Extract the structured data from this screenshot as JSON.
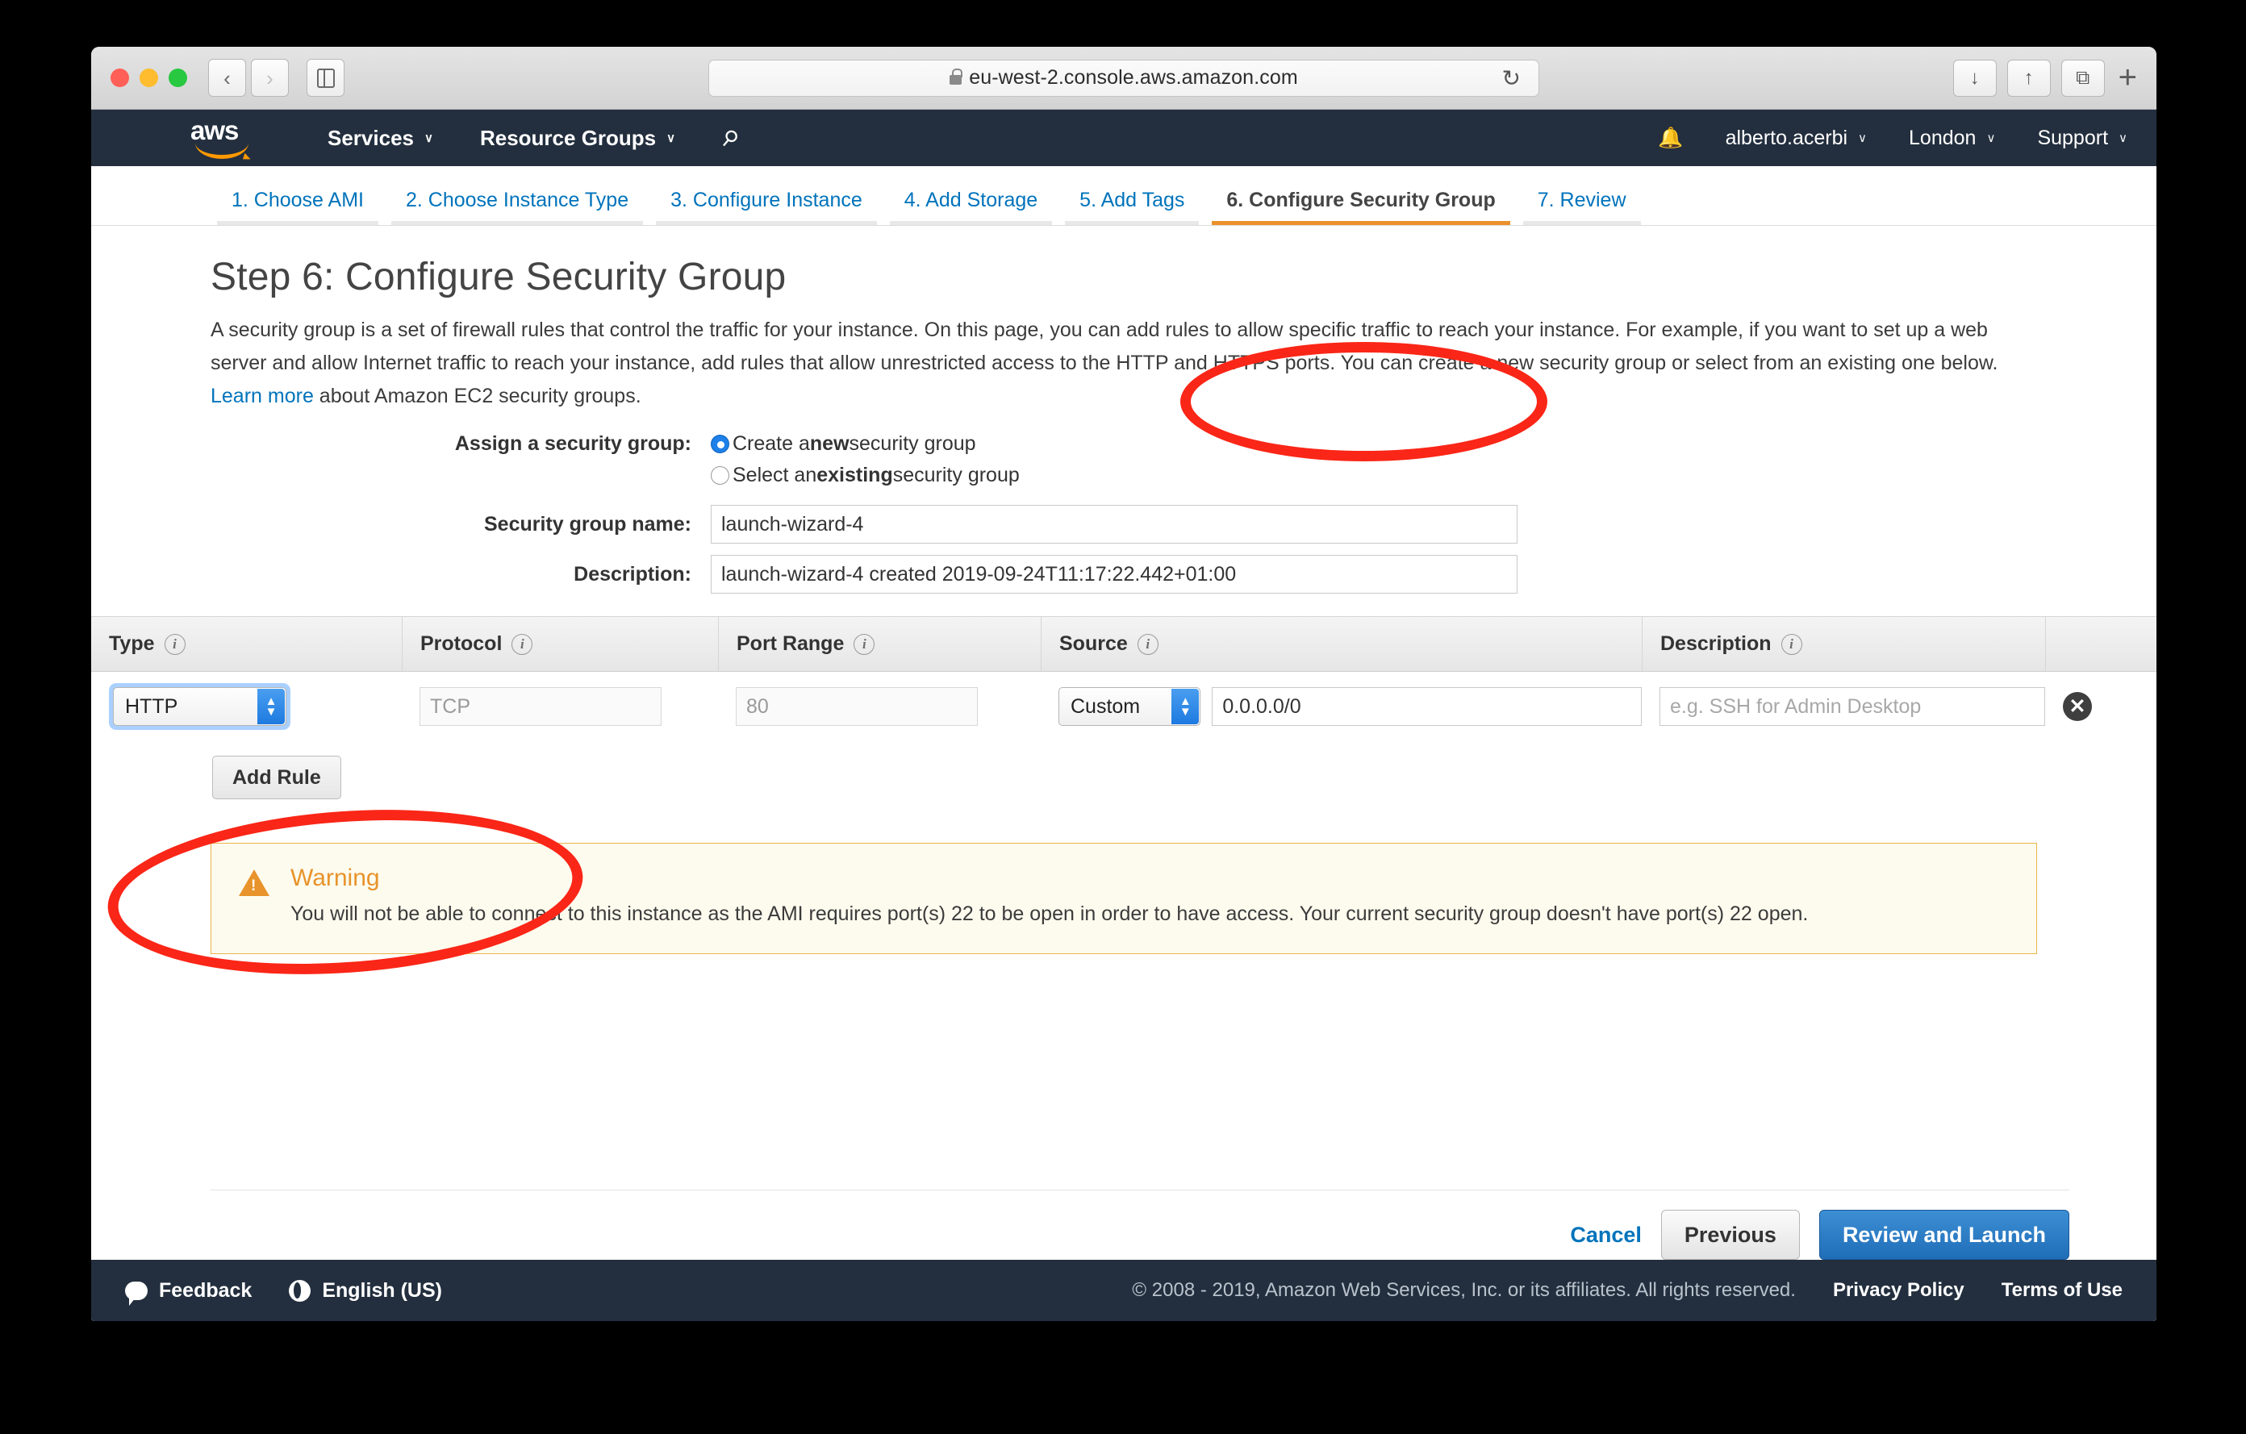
{
  "browser": {
    "url": "eu-west-2.console.aws.amazon.com",
    "lock_icon": "lock-icon",
    "back_icon": "‹",
    "forward_icon": "›",
    "reload_icon": "↻",
    "download_icon": "↓",
    "share_icon": "↑",
    "tabs_icon": "⧉",
    "new_tab_icon": "+"
  },
  "awsnav": {
    "logo": "aws",
    "services": "Services",
    "resource_groups": "Resource Groups",
    "pin_icon": "pin-icon",
    "caret": "∨",
    "bell_icon": "notifications-bell-icon",
    "account": "alberto.acerbi",
    "region": "London",
    "support": "Support"
  },
  "steps": [
    {
      "label": "1. Choose AMI",
      "active": false
    },
    {
      "label": "2. Choose Instance Type",
      "active": false
    },
    {
      "label": "3. Configure Instance",
      "active": false
    },
    {
      "label": "4. Add Storage",
      "active": false
    },
    {
      "label": "5. Add Tags",
      "active": false
    },
    {
      "label": "6. Configure Security Group",
      "active": true
    },
    {
      "label": "7. Review",
      "active": false
    }
  ],
  "page": {
    "title": "Step 6: Configure Security Group",
    "description_1": "A security group is a set of firewall rules that control the traffic for your instance. On this page, you can add rules to allow specific traffic to reach your instance. For example, if you want to set up a web server and allow Internet traffic to reach your instance, add rules that allow unrestricted access to the HTTP and HTTPS ports. You can create a new security group or select from an existing one below. ",
    "learn_more": "Learn more",
    "description_2": " about Amazon EC2 security groups."
  },
  "form": {
    "assign_label": "Assign a security group:",
    "option_new_prefix": "Create a ",
    "option_new_bold": "new",
    "option_new_suffix": " security group",
    "option_existing_prefix": "Select an ",
    "option_existing_bold": "existing",
    "option_existing_suffix": " security group",
    "selected_option": "new",
    "name_label": "Security group name:",
    "name_value": "launch-wizard-4",
    "description_label": "Description:",
    "description_value": "launch-wizard-4 created 2019-09-24T11:17:22.442+01:00"
  },
  "rules_table": {
    "columns": [
      "Type",
      "Protocol",
      "Port Range",
      "Source",
      "Description"
    ],
    "info_icon": "i",
    "rows": [
      {
        "type": "HTTP",
        "protocol": "TCP",
        "port_range": "80",
        "source_select": "Custom",
        "source_value": "0.0.0.0/0",
        "description_placeholder": "e.g. SSH for Admin Desktop",
        "delete_icon": "✕"
      }
    ],
    "add_rule_label": "Add Rule"
  },
  "warning": {
    "icon": "warning-triangle-icon",
    "title": "Warning",
    "message": "You will not be able to connect to this instance as the AMI requires port(s) 22 to be open in order to have access. Your current security group doesn't have port(s) 22 open."
  },
  "actions": {
    "cancel": "Cancel",
    "previous": "Previous",
    "review_and_launch": "Review and Launch"
  },
  "footer": {
    "feedback": "Feedback",
    "language": "English (US)",
    "copyright": "© 2008 - 2019, Amazon Web Services, Inc. or its affiliates. All rights reserved.",
    "privacy_policy": "Privacy Policy",
    "terms_of_use": "Terms of Use"
  },
  "annotations": {
    "color": "#fa2617",
    "items": [
      "configure-security-group-tab",
      "type-dropdown"
    ]
  }
}
